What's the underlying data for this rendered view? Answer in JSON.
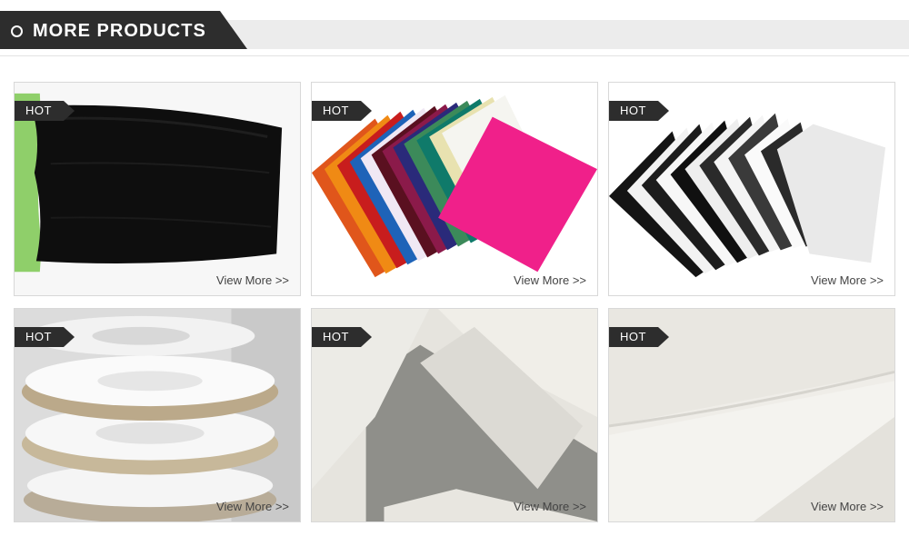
{
  "section": {
    "title": "MORE PRODUCTS"
  },
  "products": [
    {
      "badge": "HOT",
      "link_label": "View More >>",
      "image": "black-mesh-fabric-image"
    },
    {
      "badge": "HOT",
      "link_label": "View More >>",
      "image": "colored-fabric-swatches-image"
    },
    {
      "badge": "HOT",
      "link_label": "View More >>",
      "image": "black-white-fabric-swatches-image"
    },
    {
      "badge": "HOT",
      "link_label": "View More >>",
      "image": "fabric-tape-rolls-image"
    },
    {
      "badge": "HOT",
      "link_label": "View More >>",
      "image": "white-sheer-fabric-image"
    },
    {
      "badge": "HOT",
      "link_label": "View More >>",
      "image": "white-cotton-fabric-image"
    }
  ],
  "colors": {
    "dark": "#2d2d2d",
    "banner_bg": "#ececec",
    "card_border": "#d8d8d8",
    "link_text": "#444444"
  }
}
